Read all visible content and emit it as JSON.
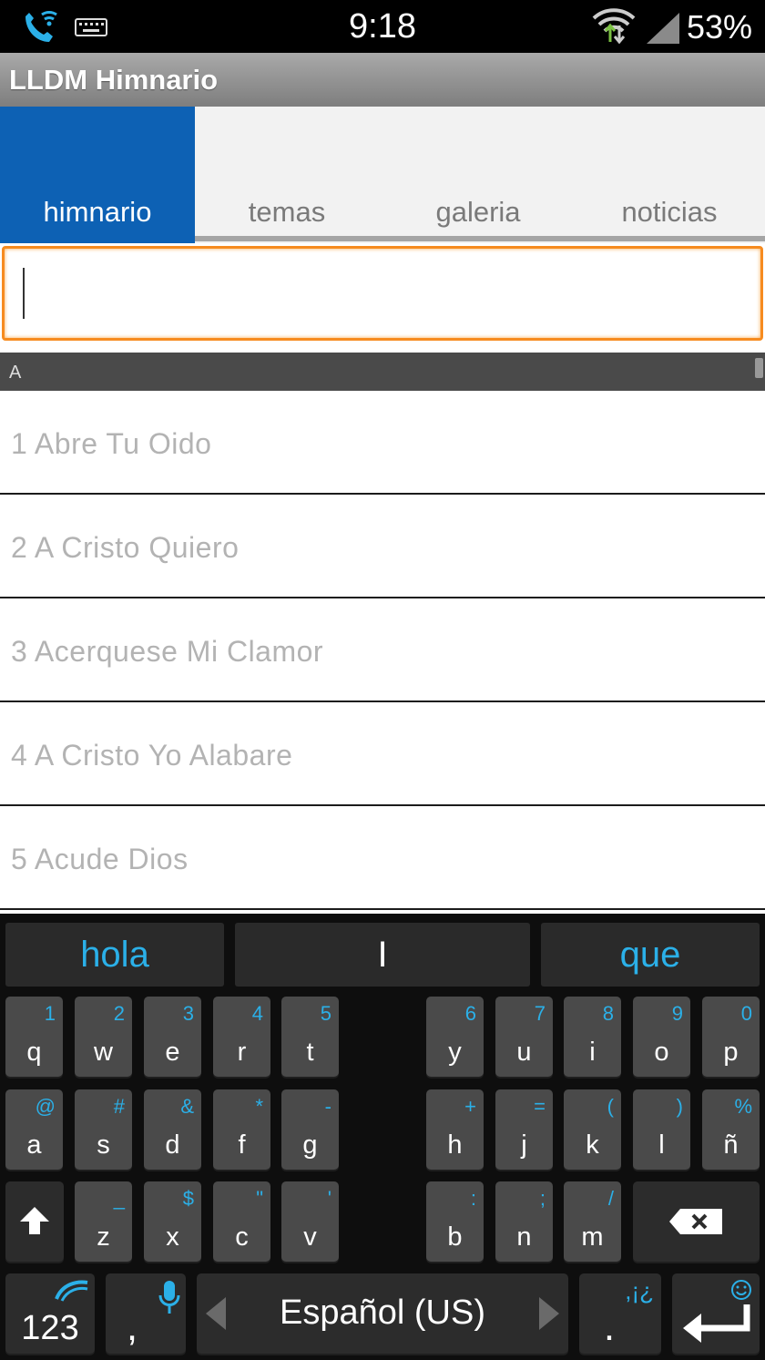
{
  "status_bar": {
    "time": "9:18",
    "battery": "53%"
  },
  "app": {
    "title": "LLDM Himnario"
  },
  "tabs": [
    {
      "label": "himnario",
      "active": true
    },
    {
      "label": "temas",
      "active": false
    },
    {
      "label": "galeria",
      "active": false
    },
    {
      "label": "noticias",
      "active": false
    }
  ],
  "search": {
    "value": "",
    "placeholder": ""
  },
  "section": {
    "letter": "A"
  },
  "hymns": [
    {
      "label": "1 Abre Tu Oido"
    },
    {
      "label": "2 A Cristo Quiero"
    },
    {
      "label": "3 Acerquese Mi Clamor"
    },
    {
      "label": "4 A Cristo Yo Alabare"
    },
    {
      "label": "5 Acude Dios"
    }
  ],
  "keyboard": {
    "suggestions": [
      "hola",
      "I",
      "que"
    ],
    "row1": [
      {
        "k": "q",
        "a": "1"
      },
      {
        "k": "w",
        "a": "2"
      },
      {
        "k": "e",
        "a": "3"
      },
      {
        "k": "r",
        "a": "4"
      },
      {
        "k": "t",
        "a": "5"
      },
      {
        "k": "y",
        "a": "6"
      },
      {
        "k": "u",
        "a": "7"
      },
      {
        "k": "i",
        "a": "8"
      },
      {
        "k": "o",
        "a": "9"
      },
      {
        "k": "p",
        "a": "0"
      }
    ],
    "row2": [
      {
        "k": "a",
        "a": "@"
      },
      {
        "k": "s",
        "a": "#"
      },
      {
        "k": "d",
        "a": "&"
      },
      {
        "k": "f",
        "a": "*"
      },
      {
        "k": "g",
        "a": "-"
      },
      {
        "k": "h",
        "a": "+"
      },
      {
        "k": "j",
        "a": "="
      },
      {
        "k": "k",
        "a": "("
      },
      {
        "k": "l",
        "a": ")"
      },
      {
        "k": "ñ",
        "a": "%"
      }
    ],
    "row3": [
      {
        "k": "z",
        "a": "_"
      },
      {
        "k": "x",
        "a": "$"
      },
      {
        "k": "c",
        "a": "\""
      },
      {
        "k": "v",
        "a": "'"
      },
      {
        "k": "b",
        "a": ":"
      },
      {
        "k": "n",
        "a": ";"
      },
      {
        "k": "m",
        "a": "/"
      }
    ],
    "numbers_label": "123",
    "comma_label": ",",
    "language": "Español (US)",
    "period_label": ".",
    "period_alt": ",¡¿"
  },
  "colors": {
    "accent_blue": "#0d61b4",
    "focus_orange": "#f68b1f",
    "key_alt": "#2bb0e8"
  }
}
